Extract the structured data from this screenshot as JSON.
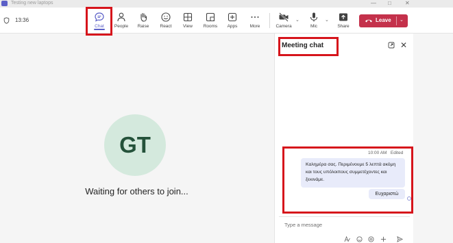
{
  "window": {
    "title": "Testing new laptops"
  },
  "header": {
    "time": "13:36"
  },
  "toolbar": {
    "items": [
      {
        "id": "chat",
        "label": "Chat",
        "icon": "chat-icon"
      },
      {
        "id": "people",
        "label": "People",
        "icon": "people-icon"
      },
      {
        "id": "raise",
        "label": "Raise",
        "icon": "hand-icon"
      },
      {
        "id": "react",
        "label": "React",
        "icon": "smiley-icon"
      },
      {
        "id": "view",
        "label": "View",
        "icon": "grid-icon"
      },
      {
        "id": "rooms",
        "label": "Rooms",
        "icon": "rooms-icon"
      },
      {
        "id": "apps",
        "label": "Apps",
        "icon": "plus-icon"
      },
      {
        "id": "more",
        "label": "More",
        "icon": "ellipsis-icon"
      }
    ],
    "media": [
      {
        "id": "camera",
        "label": "Camera",
        "icon": "camera-off-icon"
      },
      {
        "id": "mic",
        "label": "Mic",
        "icon": "mic-icon"
      },
      {
        "id": "share",
        "label": "Share",
        "icon": "share-icon"
      }
    ],
    "leave_label": "Leave"
  },
  "stage": {
    "avatar_initials": "GT",
    "waiting_text": "Waiting for others to join..."
  },
  "chat_panel": {
    "title": "Meeting chat",
    "message": {
      "time": "10:00 AM",
      "status": "Edited",
      "text": "Καλημέρα σας. Περιμένουμε 5 λεπτά ακόμη και τους υπόλοιπους συμμετέχοντες και ξεκινάμε.",
      "reply": "Ευχαριστώ"
    },
    "compose_placeholder": "Type a message"
  },
  "colors": {
    "accent": "#5b5fc7",
    "leave": "#c4314b",
    "highlight": "#d6141b",
    "avatar_bg": "#d4e9dd",
    "bubble": "#e8ebfa"
  }
}
